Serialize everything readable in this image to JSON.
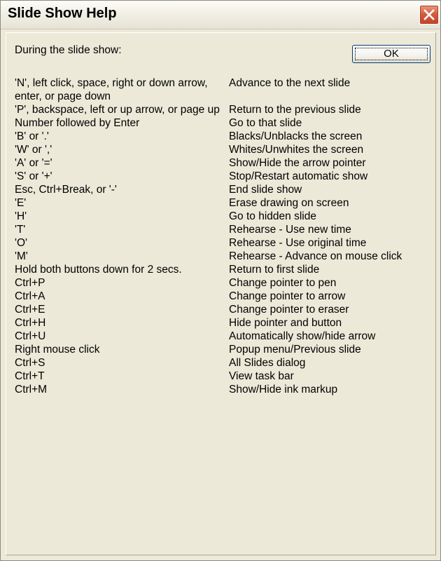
{
  "window": {
    "title": "Slide Show Help",
    "close_icon": "close-icon"
  },
  "intro": "During the slide show:",
  "ok_label": "OK",
  "shortcuts": [
    {
      "key": "'N', left click, space, right or down arrow, enter, or page down",
      "desc": "Advance to the next slide"
    },
    {
      "key": "'P', backspace, left or up arrow, or page up",
      "desc": "Return to the previous slide"
    },
    {
      "key": "Number followed by Enter",
      "desc": "Go to that slide"
    },
    {
      "key": "'B' or '.'",
      "desc": "Blacks/Unblacks the screen"
    },
    {
      "key": "'W' or ','",
      "desc": "Whites/Unwhites the screen"
    },
    {
      "key": "'A' or '='",
      "desc": "Show/Hide the arrow pointer"
    },
    {
      "key": "'S' or '+'",
      "desc": "Stop/Restart automatic show"
    },
    {
      "key": "Esc, Ctrl+Break, or '-'",
      "desc": "End slide show"
    },
    {
      "key": "'E'",
      "desc": "Erase drawing on screen"
    },
    {
      "key": "'H'",
      "desc": "Go to hidden slide"
    },
    {
      "key": "'T'",
      "desc": "Rehearse - Use new time"
    },
    {
      "key": "'O'",
      "desc": "Rehearse - Use original time"
    },
    {
      "key": "'M'",
      "desc": "Rehearse - Advance on mouse click"
    },
    {
      "key": "Hold both buttons down for 2 secs.",
      "desc": "Return to first slide"
    },
    {
      "key": "Ctrl+P",
      "desc": "Change pointer to pen"
    },
    {
      "key": "Ctrl+A",
      "desc": "Change pointer to arrow"
    },
    {
      "key": "Ctrl+E",
      "desc": "Change pointer to eraser"
    },
    {
      "key": "Ctrl+H",
      "desc": "Hide pointer and button"
    },
    {
      "key": "Ctrl+U",
      "desc": "Automatically show/hide arrow"
    },
    {
      "key": "Right mouse click",
      "desc": "Popup menu/Previous slide"
    },
    {
      "key": "Ctrl+S",
      "desc": "All Slides dialog"
    },
    {
      "key": "Ctrl+T",
      "desc": "View task bar"
    },
    {
      "key": "Ctrl+M",
      "desc": "Show/Hide ink markup"
    }
  ]
}
